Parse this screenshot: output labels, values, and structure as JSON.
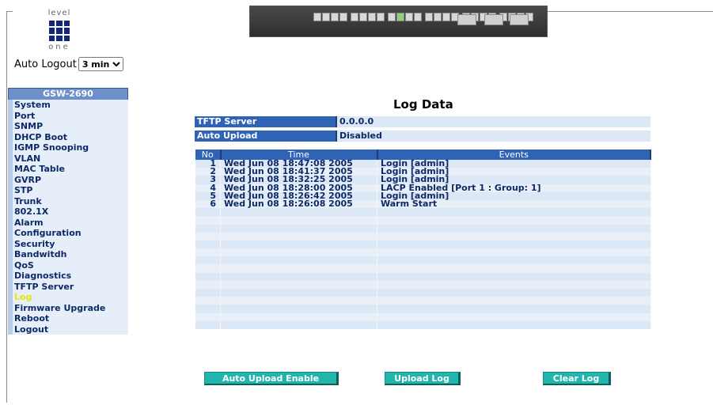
{
  "logo": {
    "top": "level",
    "bottom": "one"
  },
  "auto_logout": {
    "label": "Auto Logout",
    "value": "3 min"
  },
  "sidebar": {
    "title": "GSW-2690",
    "items": [
      "System",
      "Port",
      "SNMP",
      "DHCP Boot",
      "IGMP Snooping",
      "VLAN",
      "MAC Table",
      "GVRP",
      "STP",
      "Trunk",
      "802.1X",
      "Alarm",
      "Configuration",
      "Security",
      "Bandwitdh",
      "QoS",
      "Diagnostics",
      "TFTP Server",
      "Log",
      "Firmware Upgrade",
      "Reboot",
      "Logout"
    ],
    "active": "Log"
  },
  "main": {
    "title": "Log Data",
    "tftp_server": {
      "label": "TFTP Server",
      "value": "0.0.0.0"
    },
    "auto_upload": {
      "label": "Auto Upload",
      "value": "Disabled"
    },
    "table": {
      "headers": [
        "No",
        "Time",
        "Events"
      ],
      "rows": [
        [
          "1",
          "Wed Jun 08 18:47:08 2005",
          "Login [admin]"
        ],
        [
          "2",
          "Wed Jun 08 18:41:37 2005",
          "Login [admin]"
        ],
        [
          "3",
          "Wed Jun 08 18:32:25 2005",
          "Login [admin]"
        ],
        [
          "4",
          "Wed Jun 08 18:28:00 2005",
          "LACP Enabled [Port 1 : Group: 1]"
        ],
        [
          "5",
          "Wed Jun 08 18:26:42 2005",
          "Login [admin]"
        ],
        [
          "6",
          "Wed Jun 08 18:26:08 2005",
          "Warm Start"
        ]
      ]
    }
  },
  "buttons": {
    "auto_upload": "Auto Upload Enable",
    "upload_log": "Upload Log",
    "clear_log": "Clear Log"
  }
}
